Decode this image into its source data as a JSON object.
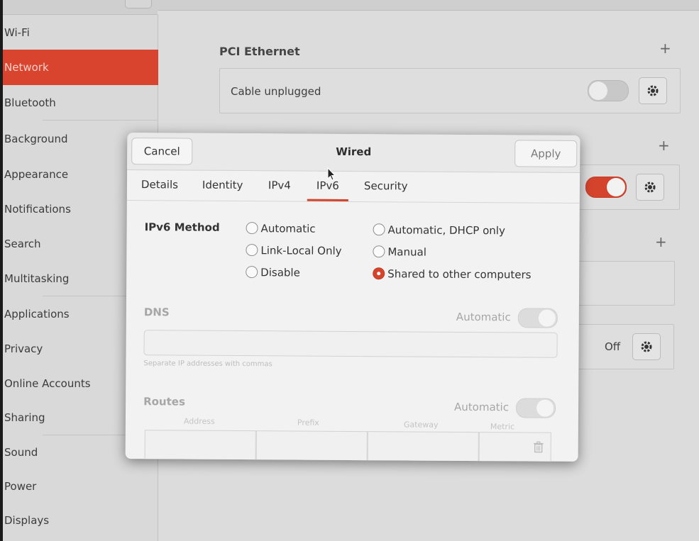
{
  "sidebar": {
    "items": [
      {
        "label": "Wi-Fi"
      },
      {
        "label": "Network",
        "selected": true
      },
      {
        "label": "Bluetooth"
      },
      {
        "label": "Background"
      },
      {
        "label": "Appearance"
      },
      {
        "label": "Notifications"
      },
      {
        "label": "Search"
      },
      {
        "label": "Multitasking"
      },
      {
        "label": "Applications"
      },
      {
        "label": "Privacy"
      },
      {
        "label": "Online Accounts"
      },
      {
        "label": "Sharing"
      },
      {
        "label": "Sound"
      },
      {
        "label": "Power"
      },
      {
        "label": "Displays"
      }
    ]
  },
  "network": {
    "pci_title": "PCI Ethernet",
    "pci_status": "Cable unplugged",
    "off_label": "Off",
    "add_icon": "plus-icon",
    "settings_icon": "gear-icon"
  },
  "dialog": {
    "title": "Wired",
    "cancel_label": "Cancel",
    "apply_label": "Apply",
    "tabs": [
      {
        "label": "Details"
      },
      {
        "label": "Identity"
      },
      {
        "label": "IPv4"
      },
      {
        "label": "IPv6",
        "active": true
      },
      {
        "label": "Security"
      }
    ],
    "method_label": "IPv6 Method",
    "methods": [
      {
        "label": "Automatic",
        "checked": false
      },
      {
        "label": "Link-Local Only",
        "checked": false
      },
      {
        "label": "Disable",
        "checked": false
      },
      {
        "label": "Automatic, DHCP only",
        "checked": false
      },
      {
        "label": "Manual",
        "checked": false
      },
      {
        "label": "Shared to other computers",
        "checked": true
      }
    ],
    "dns_label": "DNS",
    "dns_automatic_label": "Automatic",
    "dns_value": "",
    "dns_hint": "Separate IP addresses with commas",
    "routes_label": "Routes",
    "routes_automatic_label": "Automatic",
    "route_columns": [
      "Address",
      "Prefix",
      "Gateway",
      "Metric"
    ],
    "delete_icon": "trash-icon"
  },
  "colors": {
    "accent": "#d4442d",
    "selected_sidebar": "#d9442e"
  }
}
